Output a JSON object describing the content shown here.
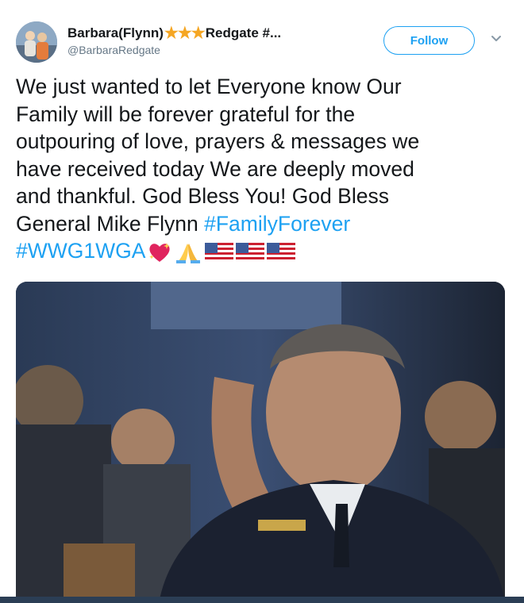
{
  "tweet": {
    "author_name": "Barbara(Flynn)",
    "author_name_suffix": "Redgate #...",
    "stars": "★★★",
    "handle": "@BarbaraRedgate",
    "follow_label": "Follow",
    "lines": [
      "We just wanted to let Everyone know Our",
      "Family will be forever grateful for the",
      "outpouring of love, prayers & messages we",
      "have received today We are deeply moved",
      "and thankful. God Bless You! God Bless",
      "General Mike Flynn "
    ],
    "hashtag_1": "#FamilyForever",
    "hashtag_2": "#WWG1WGA",
    "emoji": [
      "sparkling-heart-icon",
      "praying-hands-icon",
      "us-flag-icon",
      "us-flag-icon",
      "us-flag-icon"
    ]
  },
  "colors": {
    "accent": "#1da1f2",
    "text": "#14171a",
    "secondary_text": "#657786",
    "stars": "#f5a623"
  }
}
